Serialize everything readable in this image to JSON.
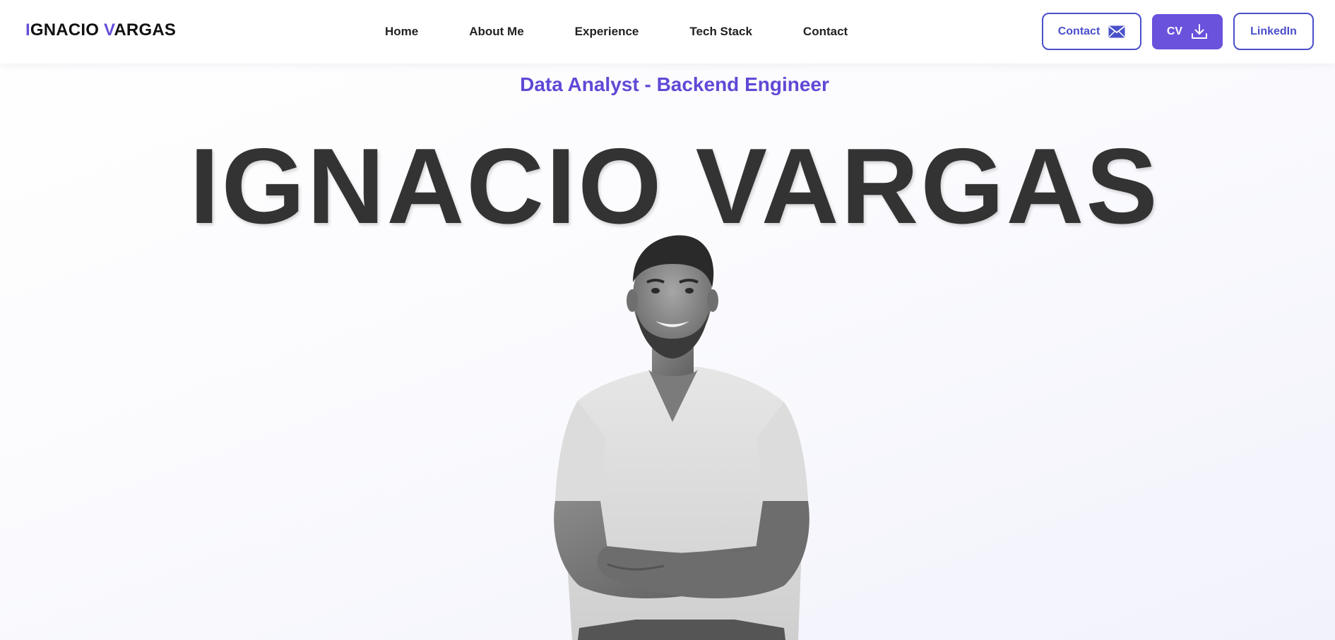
{
  "header": {
    "logo": {
      "first_initial": "I",
      "first_rest": "GNACIO ",
      "last_initial": "V",
      "last_rest": "ARGAS"
    },
    "nav": [
      {
        "label": "Home"
      },
      {
        "label": "About Me"
      },
      {
        "label": "Experience"
      },
      {
        "label": "Tech Stack"
      },
      {
        "label": "Contact"
      }
    ],
    "buttons": {
      "contact": {
        "label": "Contact",
        "icon": "envelope-icon"
      },
      "cv": {
        "label": "CV",
        "icon": "download-icon"
      },
      "linkedin": {
        "label": "LinkedIn"
      }
    }
  },
  "hero": {
    "subtitle": "Data Analyst - Backend Engineer",
    "name": "IGNACIO VARGAS",
    "portrait": "grayscale-portrait-arms-crossed"
  },
  "colors": {
    "accent": "#6450d8",
    "button_outline": "#4a4fc9",
    "button_fill": "#6a52dc",
    "heading": "#333333"
  }
}
